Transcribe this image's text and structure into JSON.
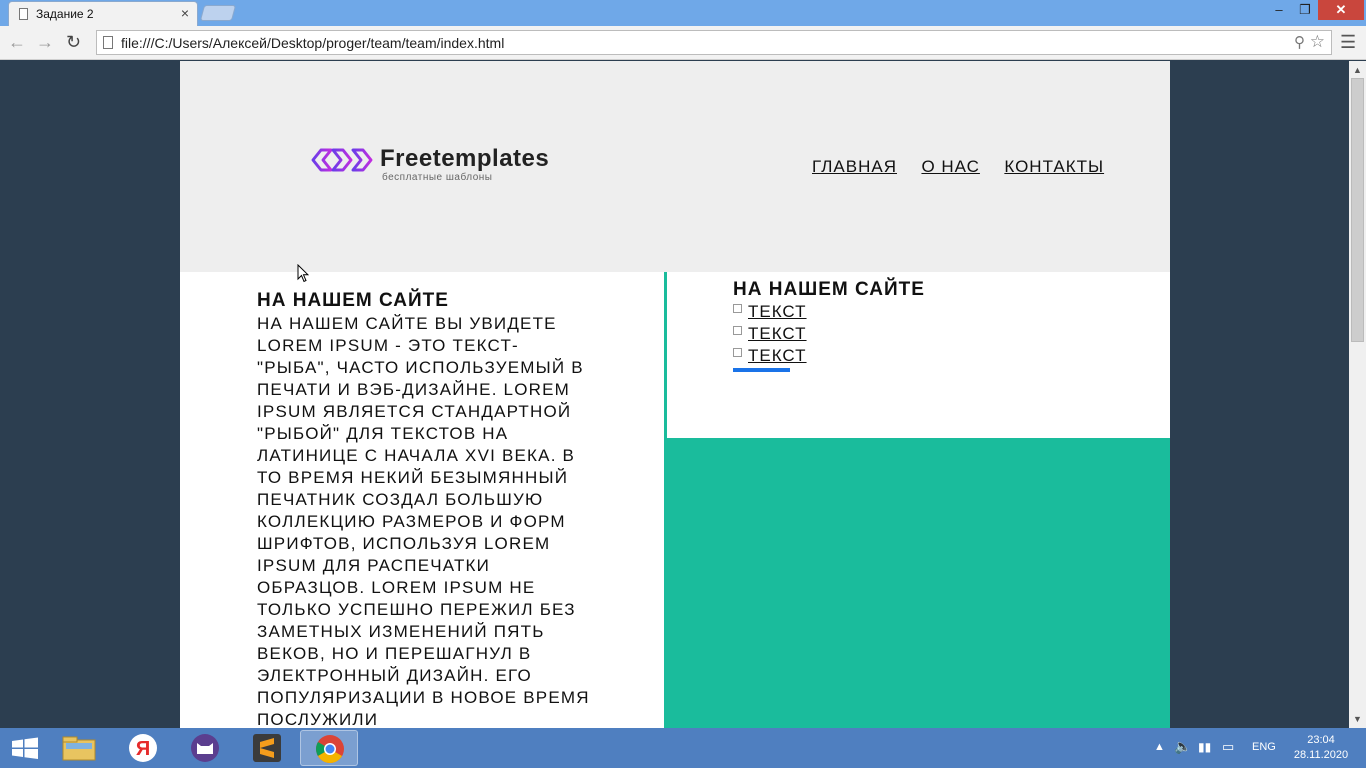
{
  "browser": {
    "tab_title": "Задание 2",
    "tab_close": "×",
    "url": "file:///C:/Users/Алексей/Desktop/proger/team/team/index.html",
    "minimize": "–",
    "maximize": "❐",
    "close": "✕"
  },
  "site": {
    "logo_name": "Freetemplates",
    "logo_sub": "бесплатные шаблоны",
    "nav": [
      "ГЛАВНАЯ",
      "О НАС",
      "КОНТАКТЫ"
    ],
    "left": {
      "heading": "НА НАШЕМ САЙТЕ",
      "text": "на нашем сайте вы увидете Lorem Ipsum - это текст-\"рыба\", часто используемый в печати и вэб-дизайне. Lorem Ipsum является стандартной \"рыбой\" для текстов на латинице с начала XVI века. В то время некий безымянный печатник создал большую коллекцию размеров и форм шрифтов, используя Lorem Ipsum для распечатки образцов. Lorem Ipsum не только успешно пережил без заметных изменений пять веков, но и перешагнул в электронный дизайн. Его популяризации в новое время послужили"
    },
    "right": {
      "heading": "НА НАШЕМ САЙТЕ",
      "items": [
        "ТЕКСТ",
        "ТЕКСТ",
        "ТЕКСТ"
      ]
    }
  },
  "taskbar": {
    "language": "ENG",
    "time": "23:04",
    "date": "28.11.2020"
  },
  "colors": {
    "page_bg": "#2c3e50",
    "header_bg": "#eeeeee",
    "accent_green": "#1abc9c",
    "accent_blue": "#1a73e8",
    "logo_purple": "#8e2de2"
  }
}
